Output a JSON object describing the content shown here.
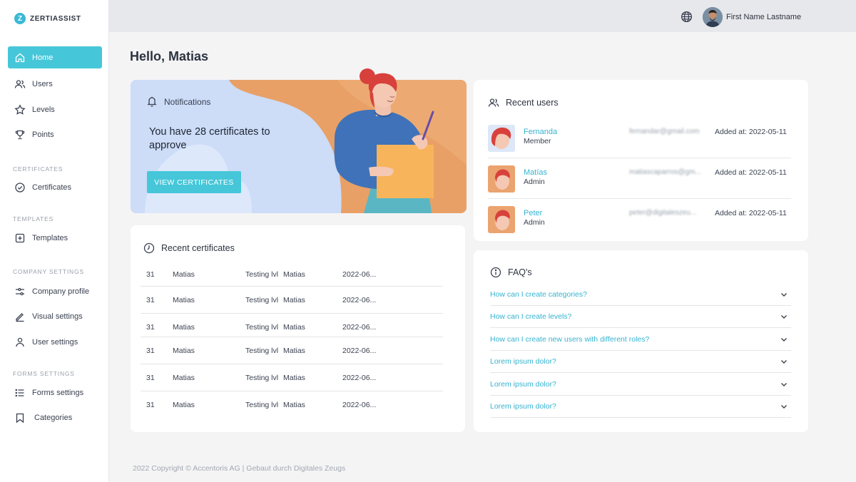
{
  "brand": {
    "logo_letter": "Z",
    "name": "ZERTIASSIST"
  },
  "sidebar": {
    "items": [
      {
        "label": "Home",
        "icon": "home-icon",
        "active": true
      },
      {
        "label": "Users",
        "icon": "users-icon"
      },
      {
        "label": "Levels",
        "icon": "star-icon"
      },
      {
        "label": "Points",
        "icon": "trophy-icon"
      }
    ],
    "sections": {
      "certificates": {
        "title": "CERTIFICATES",
        "items": [
          {
            "label": "Certificates",
            "icon": "check-circle-icon"
          }
        ]
      },
      "templates": {
        "title": "TEMPLATES",
        "items": [
          {
            "label": "Templates",
            "icon": "plus-square-icon"
          }
        ]
      },
      "company_settings": {
        "title": "COMPANY SETTINGS",
        "items": [
          {
            "label": "Company profile",
            "icon": "sliders-icon"
          },
          {
            "label": "Visual settings",
            "icon": "pen-icon"
          },
          {
            "label": "User settings",
            "icon": "user-icon"
          }
        ]
      },
      "forms_settings": {
        "title": "FORMS SETTINGS",
        "items": [
          {
            "label": "Forms settings",
            "icon": "list-icon"
          },
          {
            "label": "Categories",
            "icon": "bookmark-icon"
          }
        ]
      }
    }
  },
  "topbar": {
    "user_name": "First Name Lastname",
    "globe_icon": "globe-icon"
  },
  "greeting": "Hello, Matias",
  "notifications": {
    "title": "Notifications",
    "message": "You have 28 certificates to approve",
    "button": "VIEW CERTIFICATES"
  },
  "recent_certificates": {
    "title": "Recent certificates",
    "rows": [
      {
        "id": "31",
        "name": "Matias",
        "level": "Testing lvl",
        "issuer": "Matias",
        "date": "2022-06..."
      },
      {
        "id": "31",
        "name": "Matias",
        "level": "Testing lvl",
        "issuer": "Matias",
        "date": "2022-06..."
      },
      {
        "id": "31",
        "name": "Matias",
        "level": "Testing lvl",
        "issuer": "Matias",
        "date": "2022-06..."
      },
      {
        "id": "31",
        "name": "Matias",
        "level": "Testing lvl",
        "issuer": "Matias",
        "date": "2022-06..."
      },
      {
        "id": "31",
        "name": "Matias",
        "level": "Testing lvl",
        "issuer": "Matias",
        "date": "2022-06..."
      },
      {
        "id": "31",
        "name": "Matias",
        "level": "Testing lvl",
        "issuer": "Matias",
        "date": "2022-06..."
      }
    ]
  },
  "recent_users": {
    "title": "Recent users",
    "rows": [
      {
        "name": "Fernanda",
        "role": "Member",
        "email": "fernandar@gmail.com",
        "added": "Added at: 2022-05-11"
      },
      {
        "name": "Matías",
        "role": "Admin",
        "email": "matiascaparros@gm...",
        "added": "Added at: 2022-05-11"
      },
      {
        "name": "Peter",
        "role": "Admin",
        "email": "peter@digitaleszeu...",
        "added": "Added at: 2022-05-11"
      }
    ]
  },
  "faq": {
    "title": "FAQ's",
    "items": [
      "How can I create categories?",
      "How can I create levels?",
      "How can I create new users with different roles?",
      "Lorem ipsum dolor?",
      "Lorem ipsum dolor?",
      "Lorem ipsum dolor?"
    ]
  },
  "footer": "2022 Copyright © Accentoris AG | Gebaut durch Digitales Zeugs",
  "colors": {
    "accent": "#46c7d9",
    "link": "#36b3cf",
    "notif_bg": "#cddcf7",
    "notif_orange": "#e9a066"
  }
}
